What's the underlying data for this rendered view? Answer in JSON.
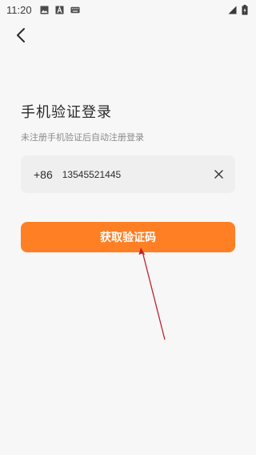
{
  "status_bar": {
    "time": "11:20",
    "icons_left": [
      "image-icon",
      "text-a-icon",
      "keyboard-icon"
    ],
    "icons_right": [
      "signal-icon",
      "battery-charging-icon"
    ]
  },
  "header": {
    "back_icon": "chevron-left-icon"
  },
  "login": {
    "title": "手机验证登录",
    "subtitle": "未注册手机验证后自动注册登录",
    "country_code": "+86",
    "phone_value": "13545521445",
    "clear_icon": "close-icon",
    "submit_label": "获取验证码"
  },
  "colors": {
    "accent": "#ff7f24",
    "background": "#f7f7f7",
    "field_bg": "#efefef",
    "annotation_arrow": "#c0202a"
  }
}
